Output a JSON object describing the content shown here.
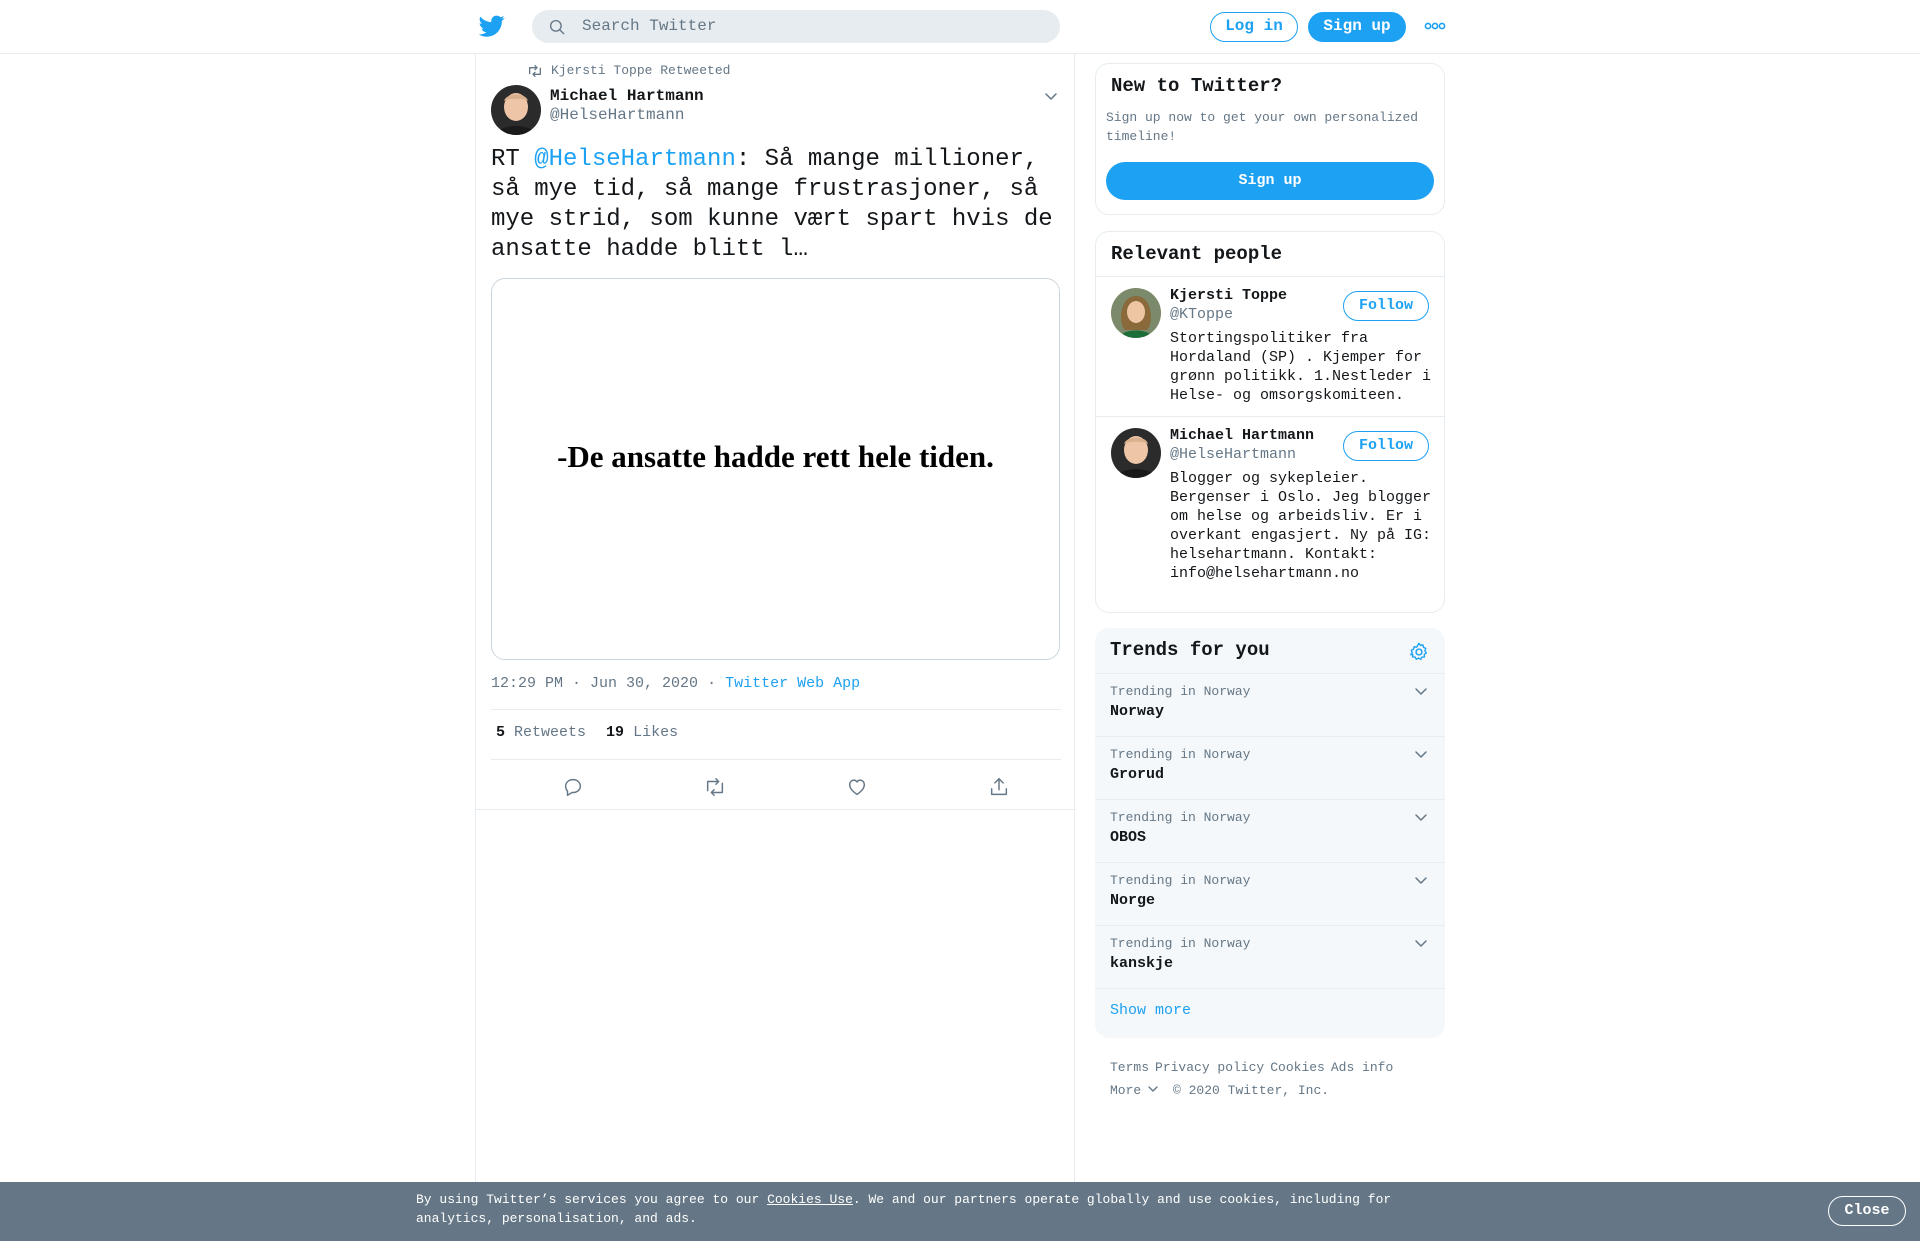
{
  "header": {
    "search_placeholder": "Search Twitter",
    "login_label": "Log in",
    "signup_label": "Sign up"
  },
  "tweet": {
    "retweeted_by": "Kjersti Toppe Retweeted",
    "author_name": "Michael Hartmann",
    "author_handle": "@HelseHartmann",
    "text_prefix": "RT ",
    "text_mention": "@HelseHartmann",
    "text_body": ": Så mange millioner, så mye tid, så mange frustrasjoner, så mye strid, som kunne vært spart hvis de ansatte hadde blitt l…",
    "media_caption": "-De ansatte hadde rett hele tiden.",
    "time": "12:29 PM · Jun 30, 2020",
    "separator": "·",
    "source": "Twitter Web App",
    "retweets_count": "5",
    "retweets_label": "Retweets",
    "likes_count": "19",
    "likes_label": "Likes"
  },
  "new_to_twitter": {
    "title": "New to Twitter?",
    "subtitle": "Sign up now to get your own personalized timeline!",
    "button": "Sign up"
  },
  "relevant_people": {
    "title": "Relevant people",
    "people": [
      {
        "name": "Kjersti Toppe",
        "handle": "@KToppe",
        "bio": "Stortingspolitiker fra Hordaland (SP) . Kjemper for grønn politikk. 1.Nestleder i Helse- og omsorgskomiteen.",
        "follow": "Follow"
      },
      {
        "name": "Michael Hartmann",
        "handle": "@HelseHartmann",
        "bio": "Blogger og sykepleier. Bergenser i Oslo. Jeg blogger om helse og arbeidsliv. Er i overkant engasjert. Ny på IG: helsehartmann. Kontakt: info@helsehartmann.no",
        "follow": "Follow"
      }
    ]
  },
  "trends": {
    "title": "Trends for you",
    "items": [
      {
        "meta": "Trending in Norway",
        "name": "Norway"
      },
      {
        "meta": "Trending in Norway",
        "name": "Grorud"
      },
      {
        "meta": "Trending in Norway",
        "name": "OBOS"
      },
      {
        "meta": "Trending in Norway",
        "name": "Norge"
      },
      {
        "meta": "Trending in Norway",
        "name": "kanskje"
      }
    ],
    "show_more": "Show more"
  },
  "footer": {
    "terms": "Terms",
    "privacy": "Privacy policy",
    "cookies": "Cookies",
    "ads": "Ads info",
    "more": "More",
    "copyright": "© 2020 Twitter, Inc."
  },
  "cookie_bar": {
    "text_before": "By using Twitter’s services you agree to our ",
    "link": "Cookies Use",
    "text_after": ". We and our partners operate globally and use cookies, including for analytics, personalisation, and ads.",
    "close": "Close"
  },
  "colors": {
    "accent": "#1da1f2",
    "secondary_text": "#657786",
    "border": "#e6ecf0",
    "cookie_bar": "#657786"
  }
}
